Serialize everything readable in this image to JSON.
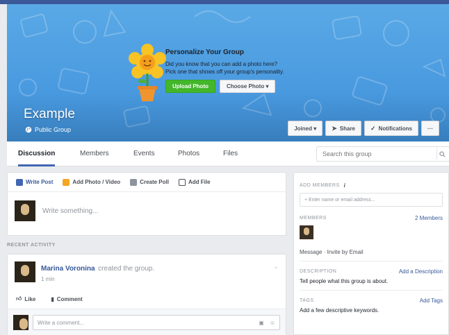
{
  "cover": {
    "promo_title": "Personalize Your Group",
    "promo_line1": "Did you know that you can add a photo here?",
    "promo_line2": "Pick one that shows off your group's personality.",
    "upload_label": "Upload Photo",
    "choose_label": "Choose Photo ▾",
    "group_name": "Example",
    "privacy": "Public Group",
    "joined_label": "Joined ▾",
    "share_label": "Share",
    "notifications_label": "Notifications",
    "more_label": "···"
  },
  "tabs": [
    "Discussion",
    "Members",
    "Events",
    "Photos",
    "Files"
  ],
  "search": {
    "placeholder": "Search this group"
  },
  "composer": {
    "tabs": [
      "Write Post",
      "Add Photo / Video",
      "Create Poll",
      "Add File"
    ],
    "placeholder": "Write something..."
  },
  "recent_activity_label": "RECENT ACTIVITY",
  "post": {
    "author": "Marina Voronina",
    "action": "created the group.",
    "time": "1 min",
    "like_label": "Like",
    "comment_label": "Comment",
    "comment_placeholder": "Write a comment..."
  },
  "right": {
    "add_members_label": "ADD MEMBERS",
    "add_members_info": "i",
    "add_members_placeholder": "+ Enter name or email address...",
    "members_label": "MEMBERS",
    "members_count": "2 Members",
    "message_link": "Message",
    "invite_link": "Invite by Email",
    "message_sep": " · ",
    "description_label": "DESCRIPTION",
    "description_link": "Add a Description",
    "description_text": "Tell people what this group is about.",
    "tags_label": "TAGS",
    "tags_link": "Add Tags",
    "tags_text": "Add a few descriptive keywords."
  },
  "colors": {
    "cover": "#4a9ae0",
    "brand": "#3b5998",
    "link": "#365899",
    "upload": "#42b72a"
  }
}
